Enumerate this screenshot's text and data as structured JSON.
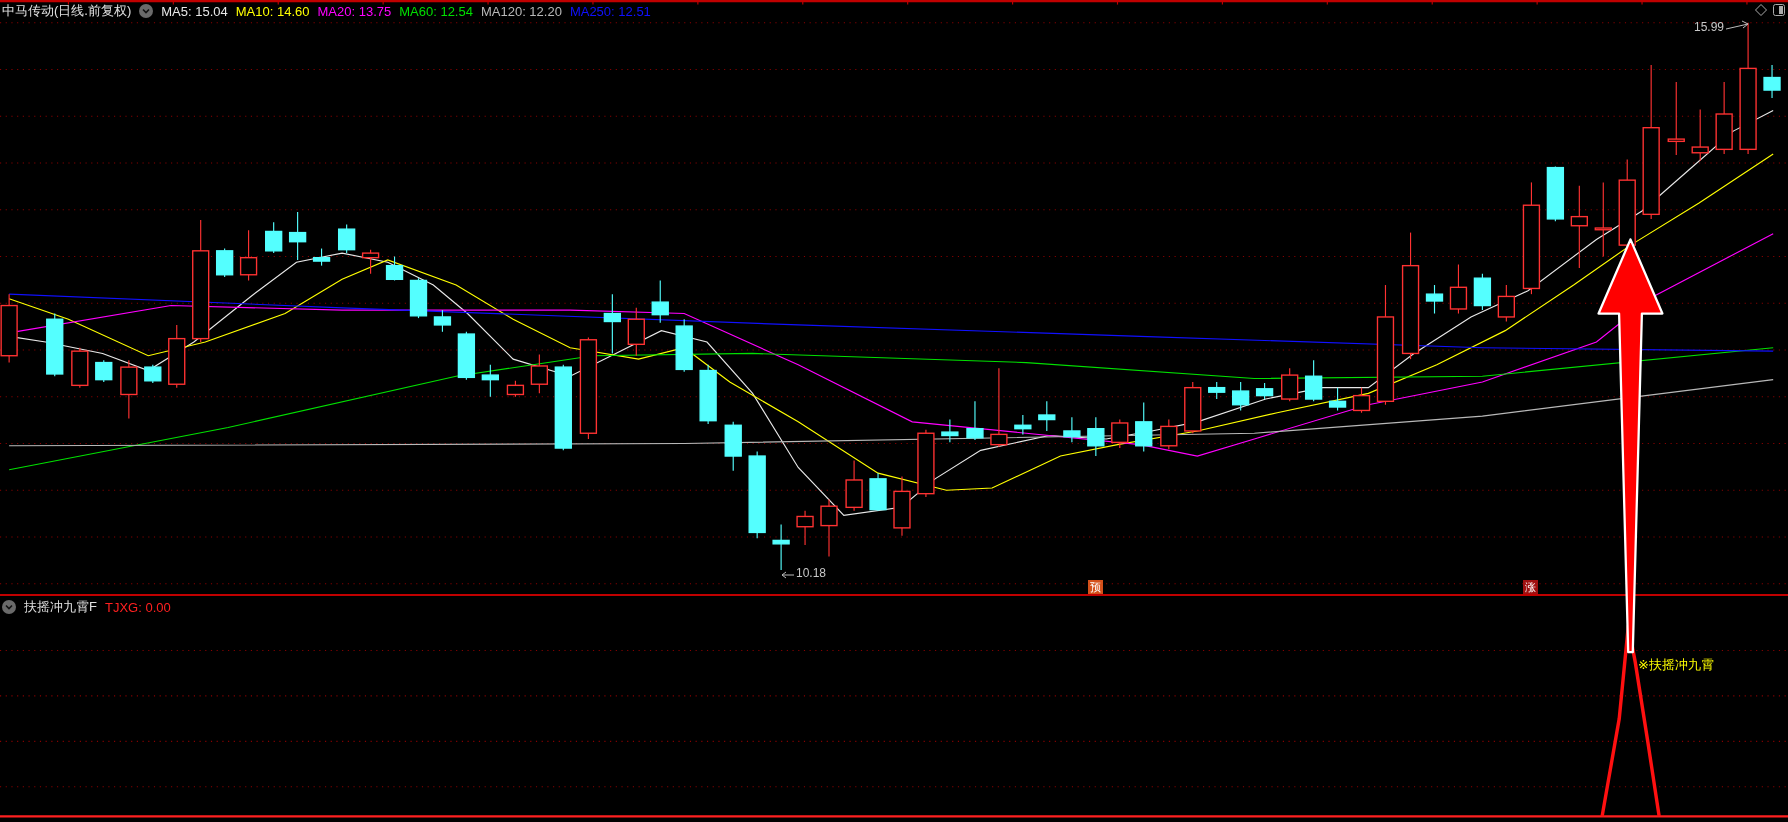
{
  "main_chart": {
    "title": "中马传动(日线.前复权)",
    "indicators": [
      {
        "label": "MA5: 15.04",
        "color": "#e8e8e8"
      },
      {
        "label": "MA10: 14.60",
        "color": "#ffff00"
      },
      {
        "label": "MA20: 13.75",
        "color": "#ff00ff"
      },
      {
        "label": "MA60: 12.54",
        "color": "#00e000"
      },
      {
        "label": "MA120: 12.20",
        "color": "#b8b8b8"
      },
      {
        "label": "MA250: 12.51",
        "color": "#1010ff"
      }
    ],
    "high_label": "15.99",
    "low_label": "10.18",
    "markers": [
      {
        "text": "预",
        "color": "#d4501a"
      },
      {
        "text": "涨",
        "color": "#a01010"
      }
    ]
  },
  "sub_chart": {
    "title": "扶摇冲九霄F",
    "value": "TJXG: 0.00",
    "signal_label": "※扶摇冲九霄"
  }
}
